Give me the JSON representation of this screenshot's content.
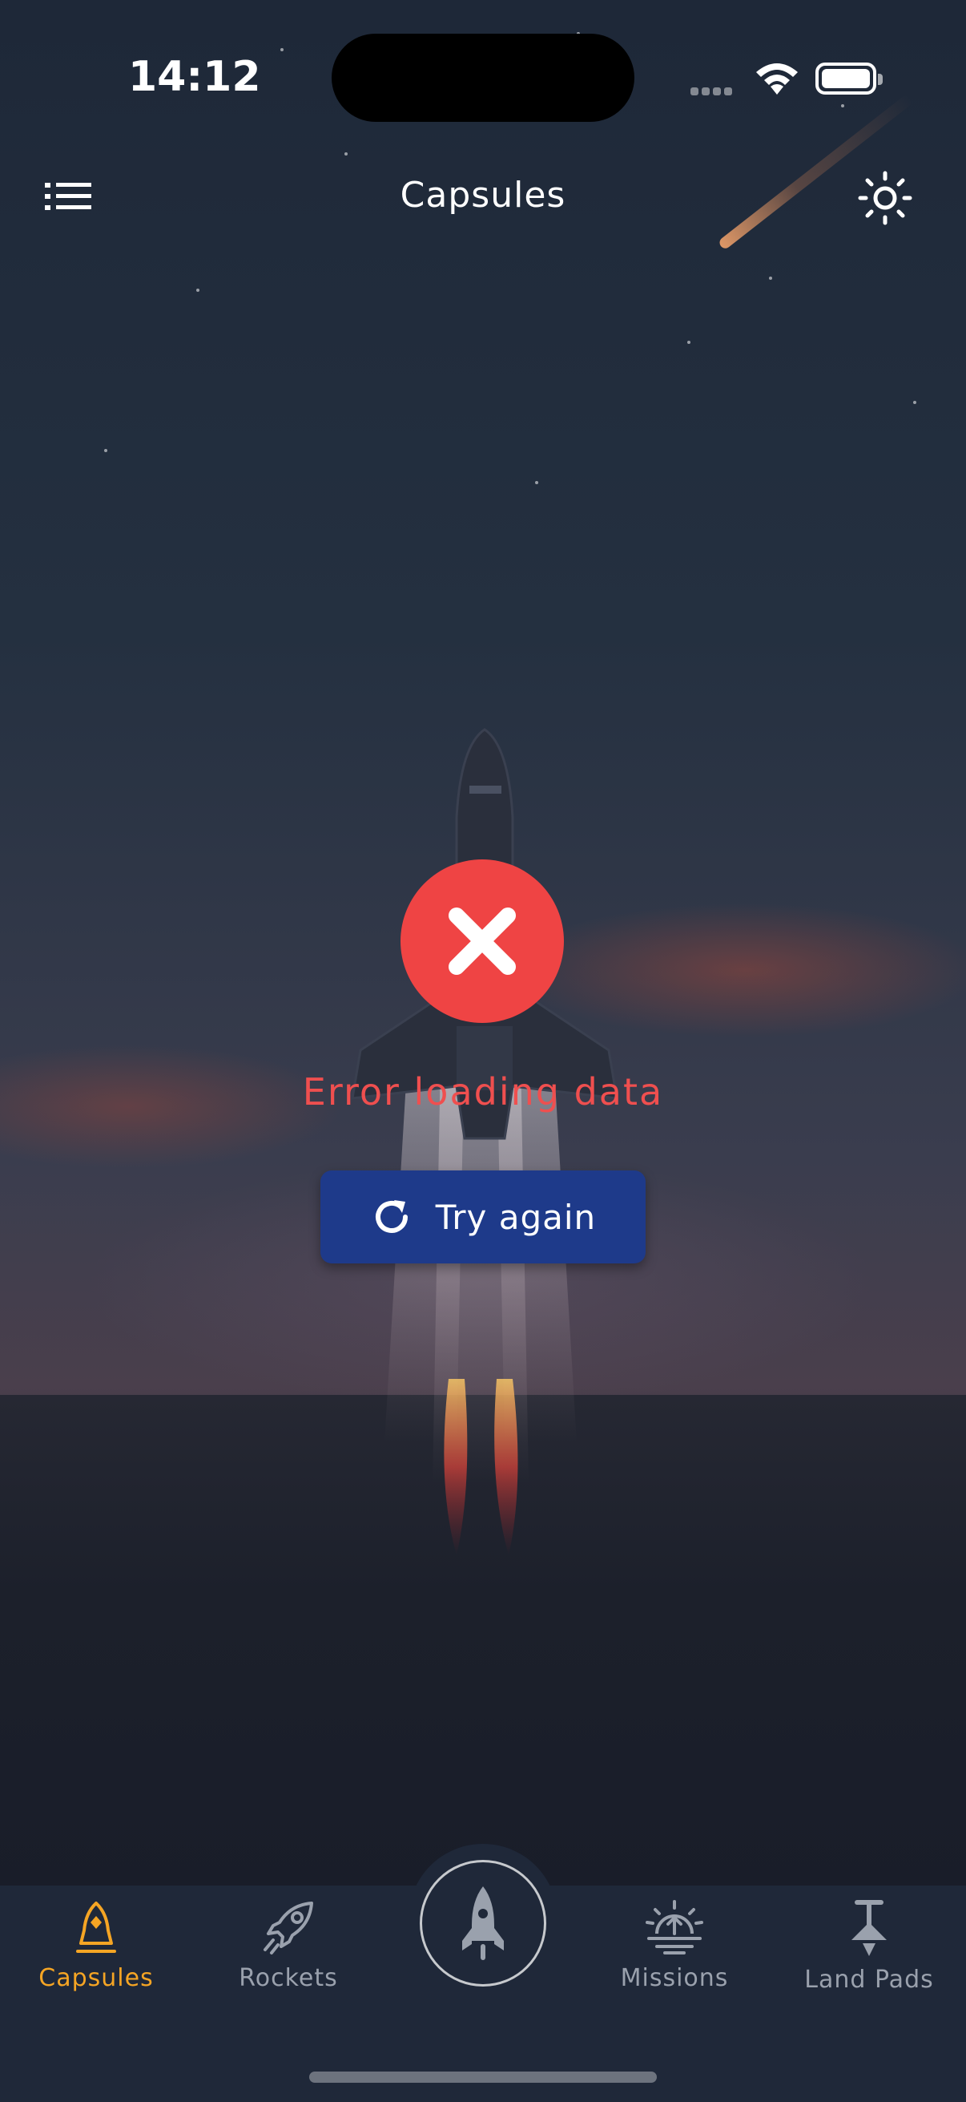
{
  "status_bar": {
    "time": "14:12",
    "icons": [
      "signal-icon",
      "wifi-icon",
      "battery-icon"
    ]
  },
  "app_bar": {
    "title": "Capsules",
    "left_icon": "menu-list-icon",
    "right_icon": "sun-theme-icon"
  },
  "error": {
    "icon": "close-x-icon",
    "message": "Error loading data",
    "retry": {
      "icon": "refresh-icon",
      "label": "Try again"
    }
  },
  "bottom_nav": {
    "items": [
      {
        "label": "Capsules",
        "icon": "capsule-icon",
        "active": true
      },
      {
        "label": "Rockets",
        "icon": "rocket-icon",
        "active": false
      },
      {
        "label": "Missions",
        "icon": "missions-icon",
        "active": false
      },
      {
        "label": "Land Pads",
        "icon": "landpad-icon",
        "active": false
      }
    ],
    "center_icon": "launch-rocket-icon"
  },
  "colors": {
    "accent": "#f5a524",
    "error": "#ef4444",
    "button": "#1e3a8a",
    "nav_background": "#1f2839",
    "inactive": "#9aa1ad"
  }
}
